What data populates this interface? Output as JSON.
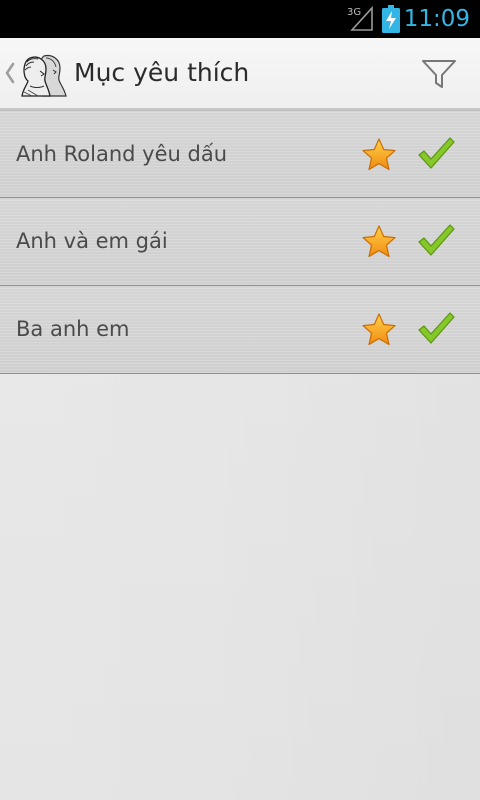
{
  "status_bar": {
    "network_label": "3G",
    "time": "11:09",
    "clock_color": "#33b5e5",
    "icons": [
      "signal-3g-icon",
      "battery-charging-icon"
    ]
  },
  "action_bar": {
    "title": "Mục yêu thích",
    "icons": [
      "back-chevron-icon",
      "app-logo-icon",
      "filter-icon"
    ]
  },
  "list": {
    "items": [
      {
        "label": "Anh Roland yêu dấu",
        "favorite": true,
        "checked": true
      },
      {
        "label": "Anh và em gái",
        "favorite": true,
        "checked": true
      },
      {
        "label": "Ba anh em",
        "favorite": true,
        "checked": true
      }
    ]
  },
  "colors": {
    "star_fill": "#f7a21b",
    "check_green": "#7cc11f",
    "title_text": "#2b2b2b",
    "item_text": "#4a4a4a"
  }
}
